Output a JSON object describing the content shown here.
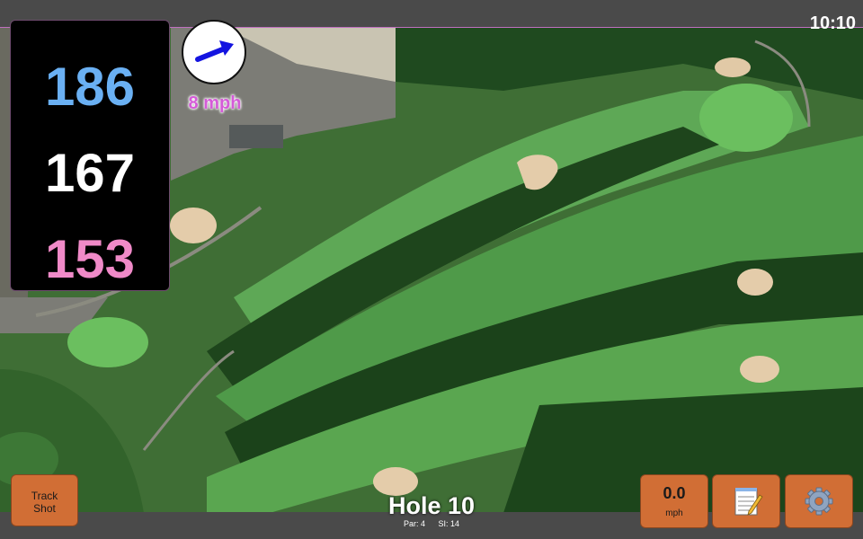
{
  "status": {
    "time": "10:10"
  },
  "distances": {
    "back": "186",
    "middle": "167",
    "front": "153"
  },
  "wind": {
    "speed_text": "8 mph",
    "arrow_icon": "wind-arrow-icon"
  },
  "hole": {
    "title": "Hole 10",
    "par": "Par: 4",
    "stroke_index": "SI: 14"
  },
  "buttons": {
    "track_shot_line1": "Track",
    "track_shot_line2": "Shot",
    "speed_value": "0.0",
    "speed_unit": "mph",
    "notes_icon": "notepad-icon",
    "settings_icon": "gear-icon"
  },
  "colors": {
    "back_distance": "#6ab0f3",
    "middle_distance": "#ffffff",
    "front_distance": "#f08ac8",
    "wind_text": "#d55bd8",
    "button_bg": "#d16e35"
  }
}
